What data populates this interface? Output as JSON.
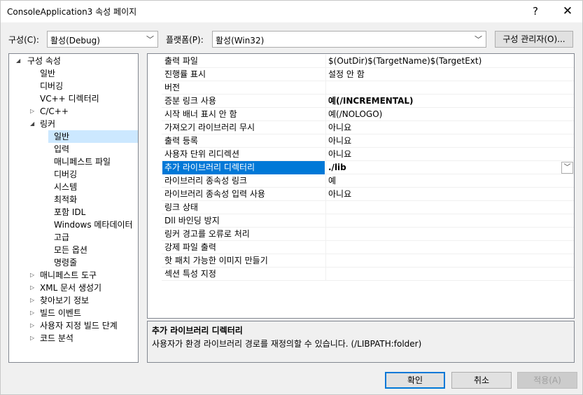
{
  "window": {
    "title": "ConsoleApplication3 속성 페이지",
    "help_label": "?",
    "close_label": "✕"
  },
  "config": {
    "label": "구성(C):",
    "value": "활성(Debug)"
  },
  "platform": {
    "label": "플랫폼(P):",
    "value": "활성(Win32)"
  },
  "config_manager_label": "구성 관리자(O)...",
  "tree": [
    {
      "label": "구성 속성",
      "toggle": "◢"
    },
    {
      "label": "일반",
      "toggle": ""
    },
    {
      "label": "디버깅",
      "toggle": ""
    },
    {
      "label": "VC++ 디렉터리",
      "toggle": ""
    },
    {
      "label": "C/C++",
      "toggle": "▷"
    },
    {
      "label": "링커",
      "toggle": "◢"
    },
    {
      "label": "일반",
      "toggle": ""
    },
    {
      "label": "입력",
      "toggle": ""
    },
    {
      "label": "매니페스트 파일",
      "toggle": ""
    },
    {
      "label": "디버깅",
      "toggle": ""
    },
    {
      "label": "시스템",
      "toggle": ""
    },
    {
      "label": "최적화",
      "toggle": ""
    },
    {
      "label": "포함 IDL",
      "toggle": ""
    },
    {
      "label": "Windows 메타데이터",
      "toggle": ""
    },
    {
      "label": "고급",
      "toggle": ""
    },
    {
      "label": "모든 옵션",
      "toggle": ""
    },
    {
      "label": "명령줄",
      "toggle": ""
    },
    {
      "label": "매니페스트 도구",
      "toggle": "▷"
    },
    {
      "label": "XML 문서 생성기",
      "toggle": "▷"
    },
    {
      "label": "찾아보기 정보",
      "toggle": "▷"
    },
    {
      "label": "빌드 이벤트",
      "toggle": "▷"
    },
    {
      "label": "사용자 지정 빌드 단계",
      "toggle": "▷"
    },
    {
      "label": "코드 분석",
      "toggle": "▷"
    }
  ],
  "properties": [
    {
      "name": "출력 파일",
      "value": "$(OutDir)$(TargetName)$(TargetExt)"
    },
    {
      "name": "진행률 표시",
      "value": "설정 안 함"
    },
    {
      "name": "버전",
      "value": ""
    },
    {
      "name": "증분 링크 사용",
      "value": "예(/INCREMENTAL)"
    },
    {
      "name": "시작 배너 표시 안 함",
      "value": "예(/NOLOGO)"
    },
    {
      "name": "가져오기 라이브러리 무시",
      "value": "아니요"
    },
    {
      "name": "출력 등록",
      "value": "아니요"
    },
    {
      "name": "사용자 단위 리디렉션",
      "value": "아니요"
    },
    {
      "name": "추가 라이브러리 디렉터리",
      "value": "./lib"
    },
    {
      "name": "라이브러리 종속성 링크",
      "value": "예"
    },
    {
      "name": "라이브러리 종속성 입력 사용",
      "value": "아니요"
    },
    {
      "name": "링크 상태",
      "value": ""
    },
    {
      "name": "Dll 바인딩 방지",
      "value": ""
    },
    {
      "name": "링커 경고를 오류로 처리",
      "value": ""
    },
    {
      "name": "강제 파일 출력",
      "value": ""
    },
    {
      "name": "핫 패치 가능한 이미지 만들기",
      "value": ""
    },
    {
      "name": "섹션 특성 지정",
      "value": ""
    }
  ],
  "description": {
    "title": "추가 라이브러리 디렉터리",
    "text": "사용자가 환경 라이브러리 경로를 재정의할 수 있습니다. (/LIBPATH:folder)"
  },
  "buttons": {
    "ok": "확인",
    "cancel": "취소",
    "apply": "적용(A)"
  },
  "icons": {
    "dropdown": "chevron-down-icon",
    "expanded": "expanded-triangle-icon",
    "collapsed": "collapsed-triangle-icon"
  },
  "colors": {
    "selection": "#0078d7",
    "tree_selection": "#cce8ff"
  }
}
